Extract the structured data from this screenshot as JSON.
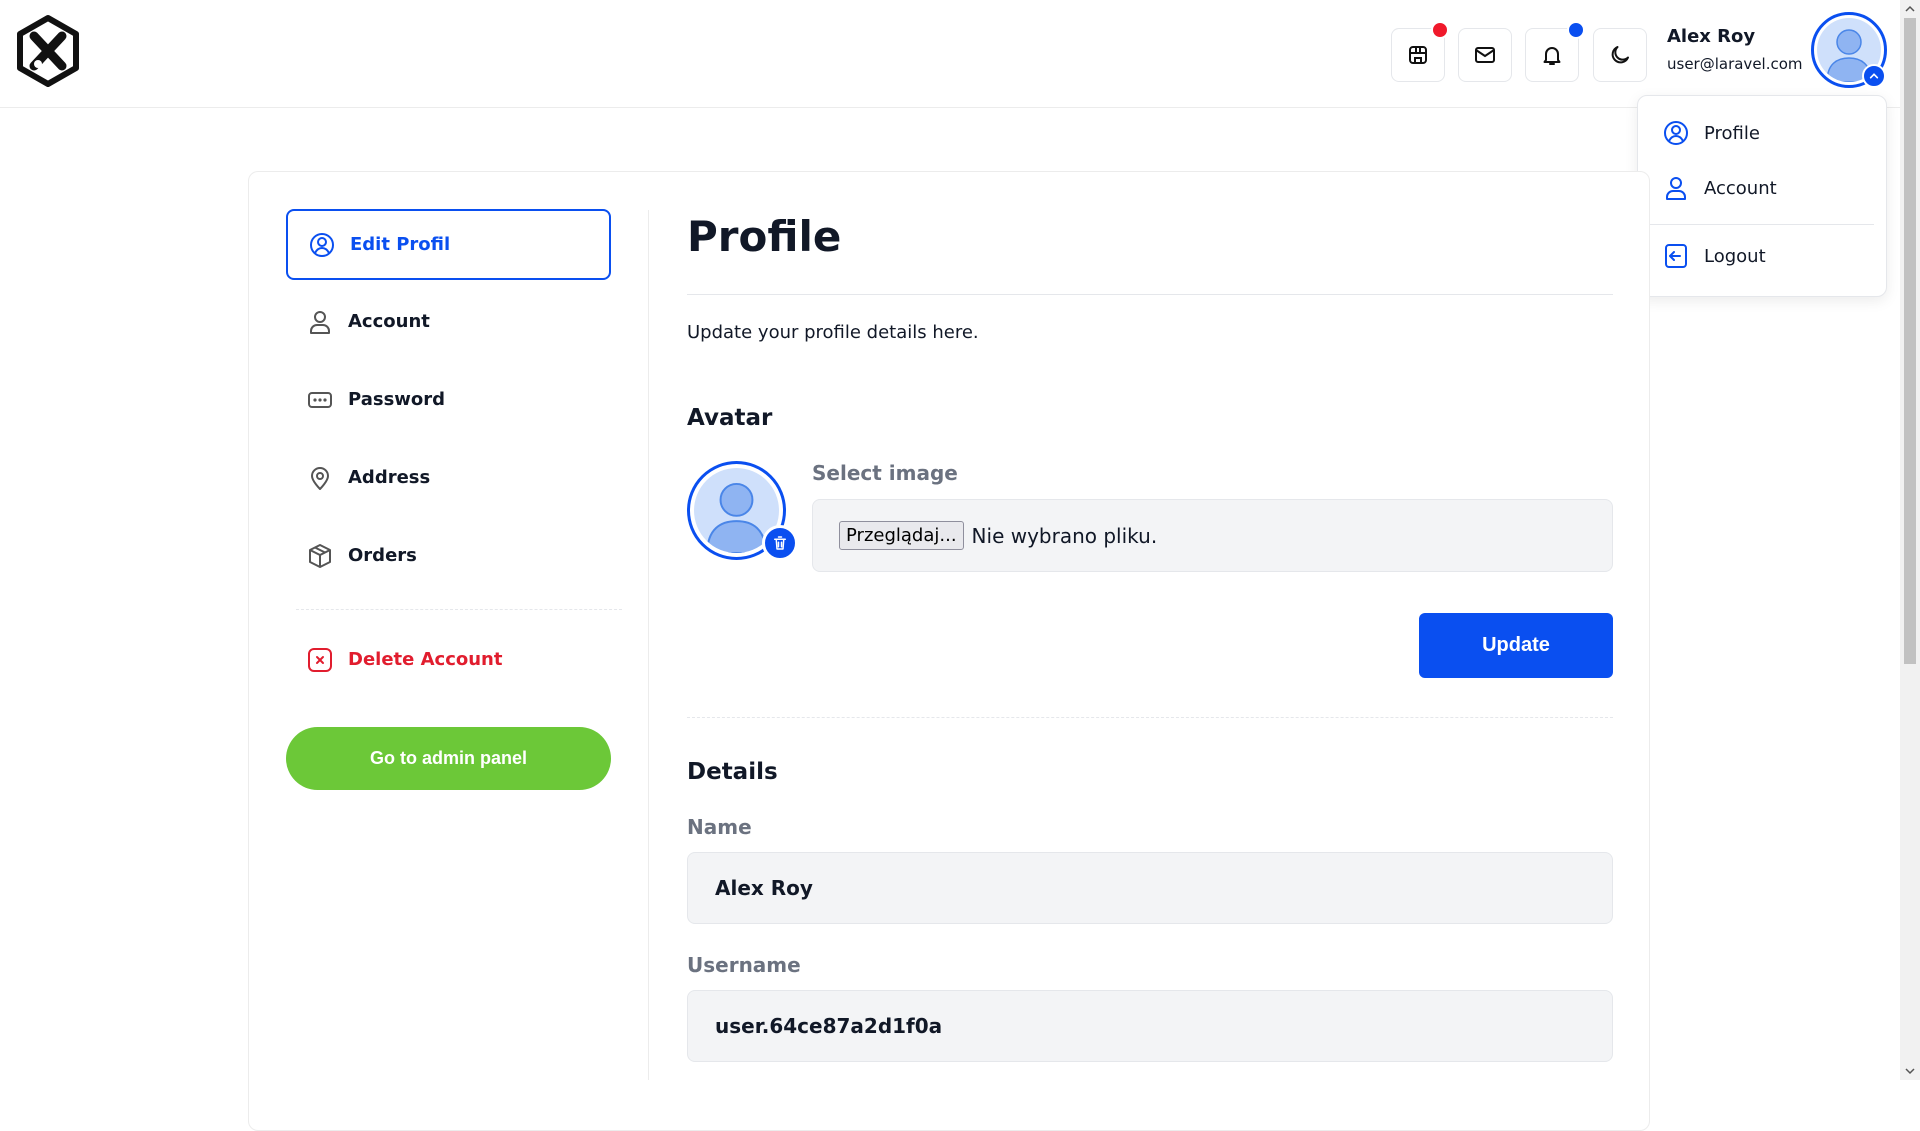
{
  "header": {
    "user_name": "Alex Roy",
    "user_email": "user@laravel.com",
    "icons": [
      "store-icon",
      "mail-icon",
      "bell-icon",
      "moon-icon"
    ],
    "badge_colors": {
      "store": "#f0192b",
      "bell": "#0a4ff0"
    }
  },
  "user_menu": {
    "items": [
      {
        "label": "Profile",
        "icon": "user-circle-icon"
      },
      {
        "label": "Account",
        "icon": "user-icon"
      },
      {
        "label": "Logout",
        "icon": "logout-icon"
      }
    ]
  },
  "sidebar": {
    "items": [
      {
        "label": "Edit Profil",
        "icon": "user-circle-icon",
        "active": true
      },
      {
        "label": "Account",
        "icon": "user-icon"
      },
      {
        "label": "Password",
        "icon": "password-icon"
      },
      {
        "label": "Address",
        "icon": "map-pin-icon"
      },
      {
        "label": "Orders",
        "icon": "box-icon"
      }
    ],
    "delete_label": "Delete Account",
    "admin_button": "Go to admin panel"
  },
  "main": {
    "title": "Profile",
    "subtitle": "Update your profile details here.",
    "avatar_heading": "Avatar",
    "select_image_label": "Select image",
    "browse_label": "Przeglądaj...",
    "file_status": "Nie wybrano pliku.",
    "update_button": "Update",
    "details_heading": "Details",
    "name_label": "Name",
    "name_value": "Alex Roy",
    "username_label": "Username",
    "username_value": "user.64ce87a2d1f0a"
  },
  "colors": {
    "accent": "#0a4ff0",
    "danger": "#e11d2e",
    "success": "#6cc838"
  }
}
